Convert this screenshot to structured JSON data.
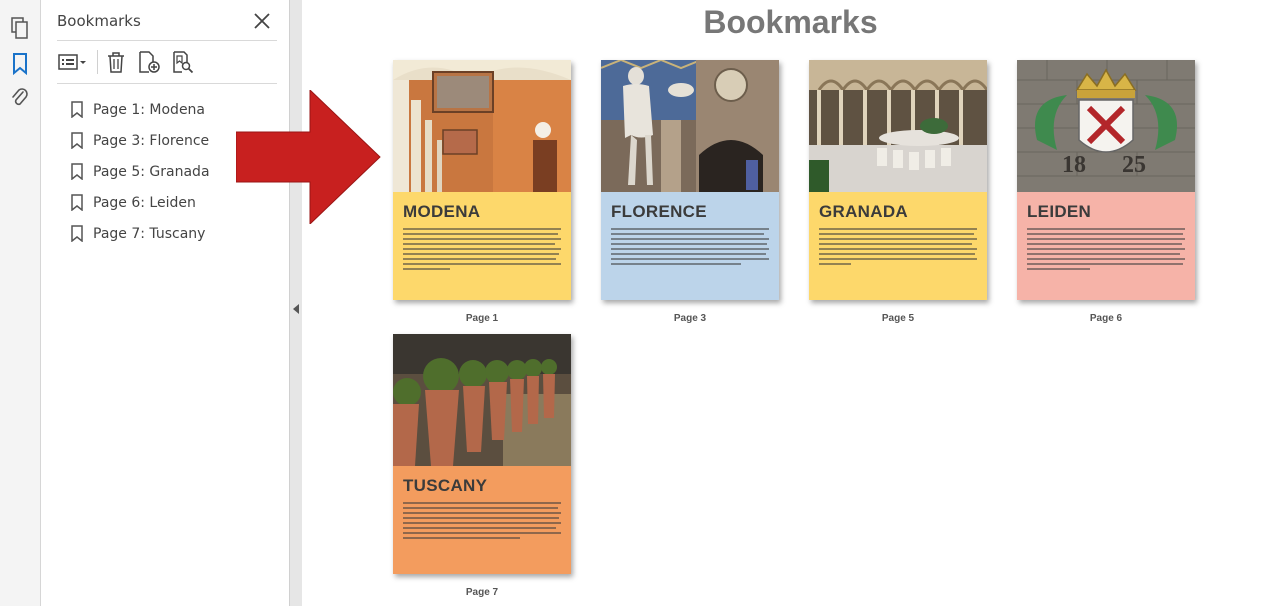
{
  "rail": {
    "icons": [
      "pages-icon",
      "bookmark-icon",
      "attachment-icon"
    ]
  },
  "panel": {
    "title": "Bookmarks",
    "toolbar": {
      "options_icon": "options-menu-icon",
      "delete_icon": "trash-icon",
      "new_icon": "new-bookmark-icon",
      "find_icon": "find-bookmark-icon"
    },
    "bookmarks": [
      {
        "label": "Page 1: Modena"
      },
      {
        "label": "Page 3: Florence"
      },
      {
        "label": "Page 5: Granada"
      },
      {
        "label": "Page 6: Leiden"
      },
      {
        "label": "Page 7: Tuscany"
      }
    ]
  },
  "main": {
    "title": "Bookmarks",
    "arrow_color": "#c8201f",
    "thumbnails": [
      {
        "city": "MODENA",
        "page": "Page 1",
        "color": "#fdd86b"
      },
      {
        "city": "FLORENCE",
        "page": "Page 3",
        "color": "#bcd4ea"
      },
      {
        "city": "GRANADA",
        "page": "Page 5",
        "color": "#fdd86b"
      },
      {
        "city": "LEIDEN",
        "page": "Page 6",
        "color": "#f6b3a8"
      },
      {
        "city": "TUSCANY",
        "page": "Page 7",
        "color": "#f39c5e"
      }
    ]
  }
}
